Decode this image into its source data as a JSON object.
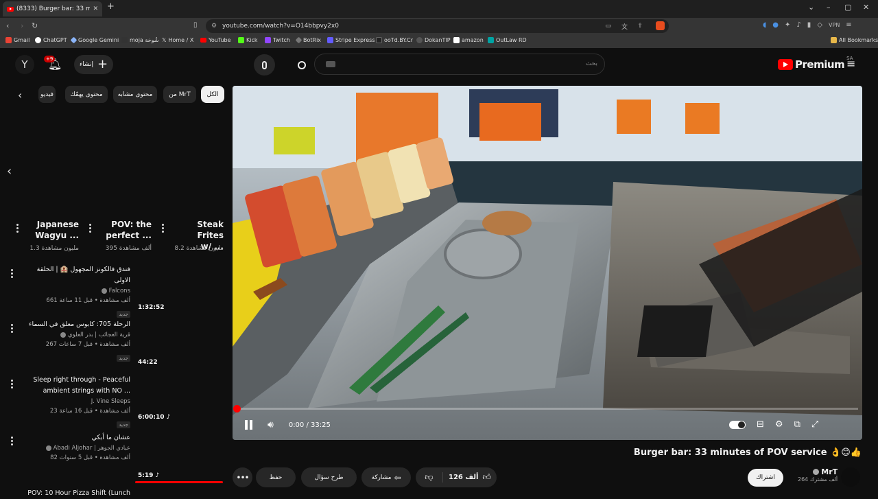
{
  "browser": {
    "tab_title": "(8333) Burger bar: 33 minut...",
    "url": "youtube.com/watch?v=O14bbpvy2x0",
    "vpn_label": "VPN",
    "bookmarks": [
      {
        "label": "Gmail",
        "color": "#ea4335"
      },
      {
        "label": "ChatGPT",
        "color": "#ffffff"
      },
      {
        "label": "Google Gemini",
        "color": "#8ab4f8"
      },
      {
        "label": "moja شُوخة",
        "color": "#222222"
      },
      {
        "label": "Home / X",
        "color": "#000000"
      },
      {
        "label": "YouTube",
        "color": "#ff0000"
      },
      {
        "label": "Kick",
        "color": "#53fc18"
      },
      {
        "label": "Twitch",
        "color": "#9146ff"
      },
      {
        "label": "BotRix",
        "color": "#444444"
      },
      {
        "label": "Stripe Express",
        "color": "#635bff"
      },
      {
        "label": "ooTd.BY.Cr",
        "color": "#222222"
      },
      {
        "label": "DokanTIP",
        "color": "#444444"
      },
      {
        "label": "amazon",
        "color": "#ffffff"
      },
      {
        "label": "OutLaw RD",
        "color": "#00a3a3"
      }
    ],
    "all_bookmarks": "All Bookmarks"
  },
  "header": {
    "avatar_letter": "Y",
    "notifications_badge": "+9",
    "create_label": "إنشاء",
    "search_placeholder": "بحث",
    "logo_text": "Premium",
    "region": "SA"
  },
  "chips": [
    "الكل",
    "من MrT",
    "محتوى مشابه",
    "محتوى يهمّك",
    "فيديو"
  ],
  "shorts": [
    {
      "title_line1": "Steak Frites",
      "title_line2": "w/ ...",
      "views": "8.2 مليون مشاهدة"
    },
    {
      "title_line1": "POV: the",
      "title_line2": "perfect ...",
      "views": "395 ألف مشاهدة"
    },
    {
      "title_line1": "Japanese",
      "title_line2": "Wagyu ...",
      "views": "1.3 مليون مشاهدة"
    }
  ],
  "videos": [
    {
      "title": "فندق فالكونز المجهول 🏨 | الحلقة الاولى",
      "channel": "Falcons",
      "meta": "661 ألف مشاهدة • قبل 11 ساعة",
      "badge": "جديد",
      "duration": "1:32:52"
    },
    {
      "title": "الرحلة 705: كابوس معلق في السماء",
      "channel": "قرية العجائب | بدر العلوي",
      "meta": "267 ألف مشاهدة • قبل 7 ساعات",
      "badge": "جديد",
      "duration": "44:22"
    },
    {
      "title": "Sleep right through - Peaceful ambient strings with NO ...",
      "channel": "J. Vine Sleeps",
      "meta": "23 ألف مشاهدة • قبل 16 ساعة",
      "badge": "جديد",
      "duration": "6:00:10"
    },
    {
      "title": "عشان ما أبكي",
      "channel": "Abadi Aljohar | عبادي الجوهر",
      "meta": "82 ألف مشاهدة • قبل 5 سنوات",
      "badge": "",
      "duration": "5:19"
    },
    {
      "title": "POV: 10 Hour Pizza Shift (Lunch",
      "channel": "",
      "meta": "",
      "badge": "",
      "duration": ""
    }
  ],
  "player": {
    "time": "0:00 / 33:25",
    "progress_fraction": 0.0
  },
  "video_info": {
    "title": "Burger bar: 33 minutes of POV service 👌😊👍",
    "channel": "MrT",
    "subscribers": "264 ألف مشترك",
    "subscribe_label": "اشتراك",
    "likes": "126 ألف",
    "share_label": "مشاركة",
    "ask_label": "طرح سؤال",
    "save_label": "حفظ"
  }
}
